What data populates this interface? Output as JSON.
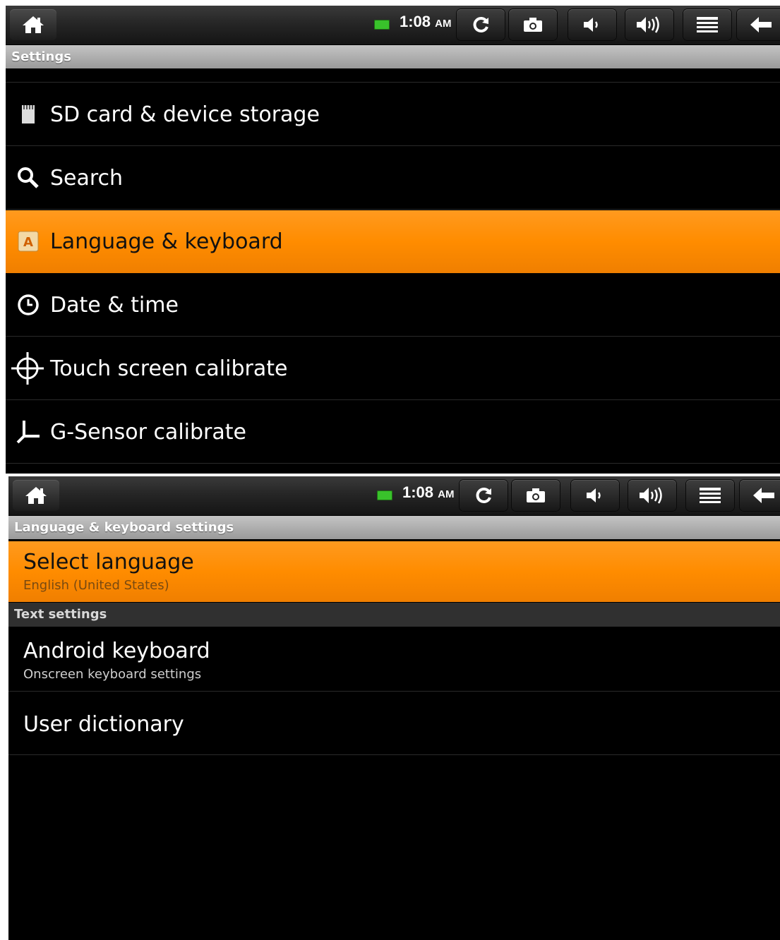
{
  "status_bar": {
    "time": "1:08",
    "ampm": "AM",
    "icons": [
      "home-icon",
      "battery-icon",
      "sync-icon",
      "camera-icon",
      "volume-down-icon",
      "volume-up-icon",
      "menu-icon",
      "back-icon"
    ],
    "battery_color": "#39c22b"
  },
  "settings_screen": {
    "title": "Settings",
    "items": [
      {
        "label": "SD card & device storage",
        "icon": "sd-card-icon"
      },
      {
        "label": "Search",
        "icon": "search-icon"
      },
      {
        "label": "Language & keyboard",
        "icon": "language-icon",
        "selected": true
      },
      {
        "label": "Date & time",
        "icon": "clock-icon"
      },
      {
        "label": "Touch screen calibrate",
        "icon": "crosshair-icon"
      },
      {
        "label": "G-Sensor calibrate",
        "icon": "axis-icon"
      }
    ]
  },
  "language_screen": {
    "title": "Language & keyboard settings",
    "select_language": {
      "title": "Select language",
      "summary": "English (United States)",
      "selected": true
    },
    "section_header": "Text settings",
    "android_keyboard": {
      "title": "Android keyboard",
      "summary": "Onscreen keyboard settings"
    },
    "user_dictionary": {
      "title": "User dictionary"
    }
  },
  "colors": {
    "highlight": "#ff8c00",
    "title_bar": "#a8a8a8",
    "background": "#000000"
  }
}
